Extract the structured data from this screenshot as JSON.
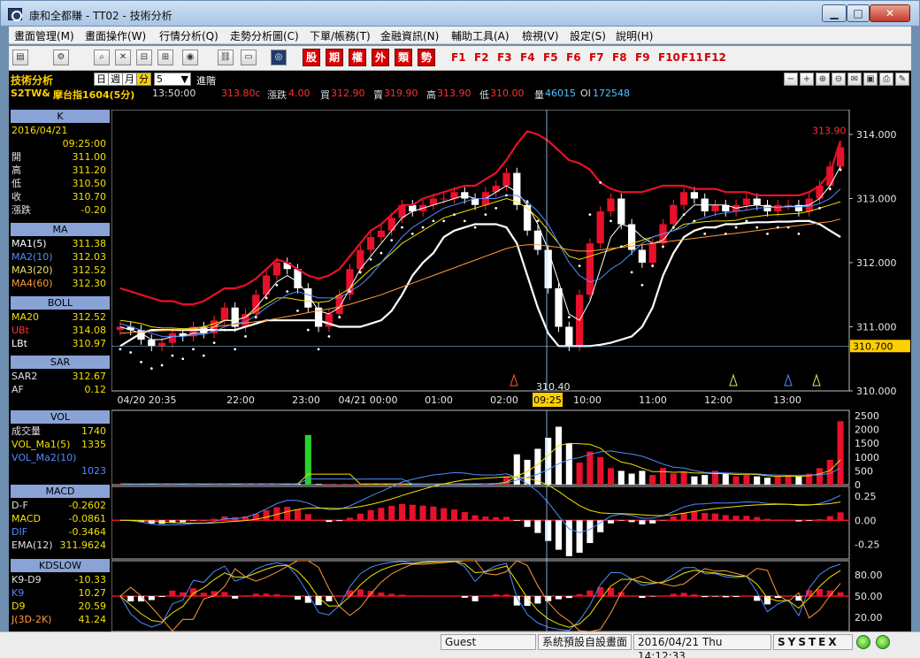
{
  "window": {
    "title": "康和全都賺 - TT02 - 技術分析",
    "minimize": "▁",
    "maximize": "□",
    "close": "✕"
  },
  "menu": [
    "畫面管理(M)",
    "畫面操作(W)",
    "行情分析(Q)",
    "走勢分析圖(C)",
    "下單/帳務(T)",
    "金融資訊(N)",
    "輔助工具(A)",
    "檢視(V)",
    "設定(S)",
    "說明(H)"
  ],
  "toolbar": {
    "red_buttons": [
      "股",
      "期",
      "權",
      "外",
      "類",
      "勢"
    ],
    "fkeys": [
      "F1",
      "F2",
      "F3",
      "F4",
      "F5",
      "F6",
      "F7",
      "F8",
      "F9",
      "F10",
      "F11",
      "F12"
    ]
  },
  "header": {
    "title": "技術分析",
    "periods": [
      "日",
      "週",
      "月",
      "分"
    ],
    "active_period": "分",
    "interval_value": "5",
    "advanced": "進階",
    "symbol": "S2TW&",
    "symbol_name": "摩台指1604(5分)",
    "time": "13:50:00",
    "last": "313.80c",
    "change_label": "漲跌",
    "change": "4.00",
    "bid_label": "買",
    "bid": "312.90",
    "ask_label": "賣",
    "ask": "319.90",
    "high_label": "高",
    "high": "313.90",
    "low_label": "低",
    "low": "310.00",
    "vol_label": "量",
    "vol": "46015",
    "oi_label": "OI",
    "oi": "172548",
    "right_icons": [
      "minus-icon",
      "plus-icon",
      "zoom-in-icon",
      "zoom-out-icon",
      "chat-icon",
      "save-icon",
      "print-icon",
      "paint-icon"
    ]
  },
  "panels": {
    "k": {
      "title": "K",
      "date": "2016/04/21",
      "time": "09:25:00",
      "rows": [
        {
          "k": "開",
          "v": "311.00"
        },
        {
          "k": "高",
          "v": "311.20"
        },
        {
          "k": "低",
          "v": "310.50"
        },
        {
          "k": "收",
          "v": "310.70"
        },
        {
          "k": "漲跌",
          "v": "-0.20"
        }
      ]
    },
    "ma": {
      "title": "MA",
      "rows": [
        {
          "k": "MA1(5)",
          "v": "311.38",
          "c": "#ffffff"
        },
        {
          "k": "MA2(10)",
          "v": "312.03",
          "c": "#4f8cff"
        },
        {
          "k": "MA3(20)",
          "v": "312.52",
          "c": "#e8e26a"
        },
        {
          "k": "MA4(60)",
          "v": "312.30",
          "c": "#ff9a3c"
        }
      ]
    },
    "boll": {
      "title": "BOLL",
      "rows": [
        {
          "k": "MA20",
          "v": "312.52",
          "c": "#f0e000"
        },
        {
          "k": "UBt",
          "v": "314.08",
          "c": "#ff3030"
        },
        {
          "k": "LBt",
          "v": "310.97",
          "c": "#ffffff"
        }
      ]
    },
    "sar": {
      "title": "SAR",
      "rows": [
        {
          "k": "SAR2",
          "v": "312.67"
        },
        {
          "k": "AF",
          "v": "0.12"
        }
      ]
    },
    "vol": {
      "title": "VOL",
      "rows": [
        {
          "k": "成交量",
          "v": "1740"
        },
        {
          "k": "VOL_Ma1(5)",
          "v": "1335"
        },
        {
          "k": "VOL_Ma2(10)",
          "v": ""
        },
        {
          "k": "",
          "v": "1023"
        }
      ]
    },
    "macd": {
      "title": "MACD",
      "rows": [
        {
          "k": "D-F",
          "v": "-0.2602"
        },
        {
          "k": "MACD",
          "v": "-0.0861"
        },
        {
          "k": "DIF",
          "v": "-0.3464"
        },
        {
          "k": "EMA(12)",
          "v": "311.9624"
        }
      ]
    },
    "kd": {
      "title": "KDSLOW",
      "rows": [
        {
          "k": "K9-D9",
          "v": "-10.33"
        },
        {
          "k": "K9",
          "v": "10.27"
        },
        {
          "k": "D9",
          "v": "20.59"
        },
        {
          "k": "J(3D-2K)",
          "v": "41.24"
        }
      ]
    }
  },
  "chart_data": {
    "type": "line",
    "main": {
      "ylim": [
        310.0,
        314.0
      ],
      "y_ticks": [
        "314.000",
        "313.000",
        "312.000",
        "311.000",
        "310.000"
      ],
      "x_ticks": [
        "04/20 20:35",
        "22:00",
        "23:00",
        "04/21 00:00",
        "01:00",
        "02:00",
        "09:25",
        "10:00",
        "11:00",
        "12:00",
        "13:00"
      ],
      "cursor_label": "09:25",
      "cursor_price": "310.700",
      "low_annotation": "310.40",
      "high_annotation": "313.90",
      "close": [
        311.0,
        310.95,
        310.8,
        310.7,
        310.75,
        310.9,
        310.85,
        311.0,
        310.9,
        311.1,
        311.3,
        311.0,
        311.2,
        311.5,
        311.8,
        312.0,
        311.9,
        311.6,
        311.3,
        311.0,
        311.2,
        311.5,
        311.9,
        312.2,
        312.4,
        312.5,
        312.7,
        312.9,
        312.8,
        312.9,
        313.0,
        313.0,
        313.1,
        313.0,
        312.9,
        313.1,
        313.2,
        313.4,
        312.9,
        312.5,
        312.2,
        311.6,
        311.0,
        310.7,
        311.5,
        312.3,
        312.8,
        313.0,
        312.6,
        312.2,
        312.0,
        312.3,
        312.6,
        312.9,
        313.1,
        313.0,
        312.8,
        312.9,
        312.8,
        312.9,
        313.0,
        312.9,
        312.8,
        312.9,
        312.9,
        312.8,
        313.0,
        313.2,
        313.5,
        313.8
      ],
      "series": [
        {
          "name": "UBt",
          "color": "#e8102a",
          "values": [
            311.6,
            311.55,
            311.5,
            311.45,
            311.4,
            311.4,
            311.35,
            311.35,
            311.4,
            311.5,
            311.6,
            311.6,
            311.65,
            311.75,
            311.9,
            312.05,
            312.0,
            311.9,
            311.8,
            311.75,
            311.8,
            311.9,
            312.1,
            312.3,
            312.5,
            312.6,
            312.75,
            312.9,
            312.9,
            313.0,
            313.05,
            313.1,
            313.15,
            313.2,
            313.2,
            313.3,
            313.4,
            313.6,
            313.85,
            314.05,
            314.0,
            313.9,
            313.75,
            313.6,
            313.55,
            313.45,
            313.25,
            313.15,
            313.1,
            313.1,
            313.1,
            313.15,
            313.2,
            313.2,
            313.2,
            313.15,
            313.15,
            313.15,
            313.1,
            313.1,
            313.1,
            313.05,
            313.05,
            313.05,
            313.05,
            313.05,
            313.1,
            313.2,
            313.4,
            313.9
          ]
        },
        {
          "name": "MA20",
          "color": "#f0e000",
          "values": [
            311.1,
            311.08,
            311.05,
            311.0,
            310.98,
            310.98,
            310.97,
            310.98,
            311.0,
            311.05,
            311.1,
            311.1,
            311.15,
            311.25,
            311.35,
            311.45,
            311.45,
            311.42,
            311.4,
            311.38,
            311.4,
            311.5,
            311.6,
            311.75,
            311.9,
            312.0,
            312.15,
            312.3,
            312.4,
            312.5,
            312.6,
            312.7,
            312.75,
            312.8,
            312.85,
            312.9,
            312.95,
            313.0,
            312.95,
            312.85,
            312.7,
            312.5,
            312.3,
            312.1,
            312.05,
            312.1,
            312.15,
            312.2,
            312.25,
            312.3,
            312.35,
            312.4,
            312.45,
            312.5,
            312.6,
            312.62,
            312.64,
            312.65,
            312.65,
            312.66,
            312.7,
            312.72,
            312.74,
            312.75,
            312.76,
            312.77,
            312.8,
            312.85,
            312.9,
            312.95
          ]
        },
        {
          "name": "LBt",
          "color": "#ffffff",
          "values": [
            310.7,
            310.8,
            310.9,
            310.95,
            310.95,
            310.95,
            310.95,
            310.95,
            310.95,
            310.95,
            310.95,
            310.95,
            311.0,
            311.05,
            311.1,
            311.1,
            311.1,
            311.1,
            311.1,
            311.1,
            311.05,
            311.0,
            311.0,
            311.0,
            311.05,
            311.1,
            311.25,
            311.5,
            311.8,
            312.0,
            312.15,
            312.4,
            312.5,
            312.55,
            312.6,
            312.6,
            312.6,
            312.55,
            312.3,
            311.8,
            311.3,
            310.9,
            310.7,
            310.7,
            310.7,
            310.7,
            310.72,
            310.75,
            310.8,
            310.85,
            311.0,
            311.3,
            311.8,
            312.15,
            312.4,
            312.5,
            312.55,
            312.55,
            312.6,
            312.6,
            312.62,
            312.63,
            312.63,
            312.64,
            312.64,
            312.65,
            312.65,
            312.6,
            312.5,
            312.4
          ]
        },
        {
          "name": "MA1(5)",
          "color": "#ffffff",
          "values": [
            311.0,
            310.95,
            310.9,
            310.8,
            310.8,
            310.85,
            310.85,
            310.9,
            310.9,
            311.0,
            311.1,
            311.1,
            311.15,
            311.3,
            311.5,
            311.7,
            311.8,
            311.7,
            311.5,
            311.25,
            311.2,
            311.3,
            311.6,
            311.9,
            312.1,
            312.3,
            312.5,
            312.7,
            312.8,
            312.85,
            312.9,
            312.95,
            313.0,
            313.05,
            313.0,
            313.0,
            313.1,
            313.2,
            313.1,
            312.9,
            312.6,
            312.2,
            311.7,
            311.2,
            311.1,
            311.4,
            311.9,
            312.4,
            312.6,
            312.55,
            312.4,
            312.3,
            312.35,
            312.55,
            312.75,
            312.9,
            312.9,
            312.9,
            312.9,
            312.85,
            312.88,
            312.9,
            312.88,
            312.86,
            312.88,
            312.88,
            312.9,
            313.0,
            313.2,
            313.5
          ]
        },
        {
          "name": "MA2(10)",
          "color": "#4f8cff",
          "values": [
            311.05,
            311.0,
            310.95,
            310.9,
            310.85,
            310.85,
            310.85,
            310.87,
            310.88,
            310.93,
            311.0,
            311.05,
            311.08,
            311.17,
            311.3,
            311.4,
            311.5,
            311.55,
            311.5,
            311.45,
            311.45,
            311.45,
            311.55,
            311.65,
            311.8,
            312.0,
            312.2,
            312.4,
            312.55,
            312.65,
            312.75,
            312.85,
            312.9,
            312.95,
            313.0,
            313.0,
            313.0,
            313.05,
            313.05,
            312.95,
            312.8,
            312.6,
            312.3,
            312.0,
            311.8,
            311.7,
            311.75,
            311.9,
            312.0,
            312.15,
            312.3,
            312.4,
            312.45,
            312.5,
            312.55,
            312.65,
            312.7,
            312.75,
            312.78,
            312.8,
            312.82,
            312.85,
            312.86,
            312.86,
            312.87,
            312.87,
            312.88,
            312.92,
            313.0,
            313.15
          ]
        },
        {
          "name": "MA4(60)",
          "color": "#ff9a3c",
          "values": [
            310.9,
            310.91,
            310.92,
            310.93,
            310.94,
            310.95,
            310.96,
            310.97,
            310.98,
            311.0,
            311.02,
            311.04,
            311.06,
            311.08,
            311.1,
            311.13,
            311.16,
            311.19,
            311.22,
            311.25,
            311.28,
            311.31,
            311.35,
            311.4,
            311.45,
            311.5,
            311.56,
            311.62,
            311.68,
            311.74,
            311.8,
            311.86,
            311.92,
            311.98,
            312.04,
            312.1,
            312.16,
            312.22,
            312.26,
            312.28,
            312.28,
            312.26,
            312.24,
            312.2,
            312.18,
            312.18,
            312.2,
            312.22,
            312.24,
            312.26,
            312.28,
            312.3,
            312.32,
            312.34,
            312.36,
            312.38,
            312.4,
            312.42,
            312.44,
            312.46,
            312.48,
            312.5,
            312.52,
            312.54,
            312.56,
            312.58,
            312.6,
            312.62,
            312.64,
            312.68
          ]
        }
      ]
    },
    "volume": {
      "y_ticks": [
        "2500",
        "2000",
        "1500",
        "1000",
        "500",
        "0"
      ],
      "ylim": [
        0,
        2500
      ],
      "values": [
        30,
        20,
        25,
        40,
        30,
        20,
        25,
        35,
        20,
        30,
        40,
        25,
        30,
        35,
        30,
        25,
        20,
        30,
        1800,
        25,
        30,
        20,
        25,
        30,
        35,
        30,
        25,
        30,
        20,
        25,
        30,
        35,
        30,
        25,
        30,
        40,
        60,
        300,
        1100,
        900,
        1300,
        1700,
        2100,
        1500,
        800,
        1200,
        1000,
        600,
        500,
        400,
        500,
        350,
        600,
        400,
        450,
        300,
        350,
        500,
        400,
        300,
        350,
        300,
        250,
        300,
        350,
        300,
        400,
        600,
        900,
        2300
      ]
    },
    "macd": {
      "y_ticks": [
        "0.25",
        "0.00",
        "-0.25"
      ],
      "ylim": [
        -0.4,
        0.35
      ]
    },
    "kd": {
      "y_ticks": [
        "80.00",
        "50.00",
        "20.00"
      ],
      "ylim": [
        0,
        100
      ]
    }
  },
  "status": {
    "user": "Guest",
    "layout": "系統預設自設畫面",
    "datetime": "2016/04/21 Thu 14:12:33",
    "brand": "SYSTEX"
  }
}
